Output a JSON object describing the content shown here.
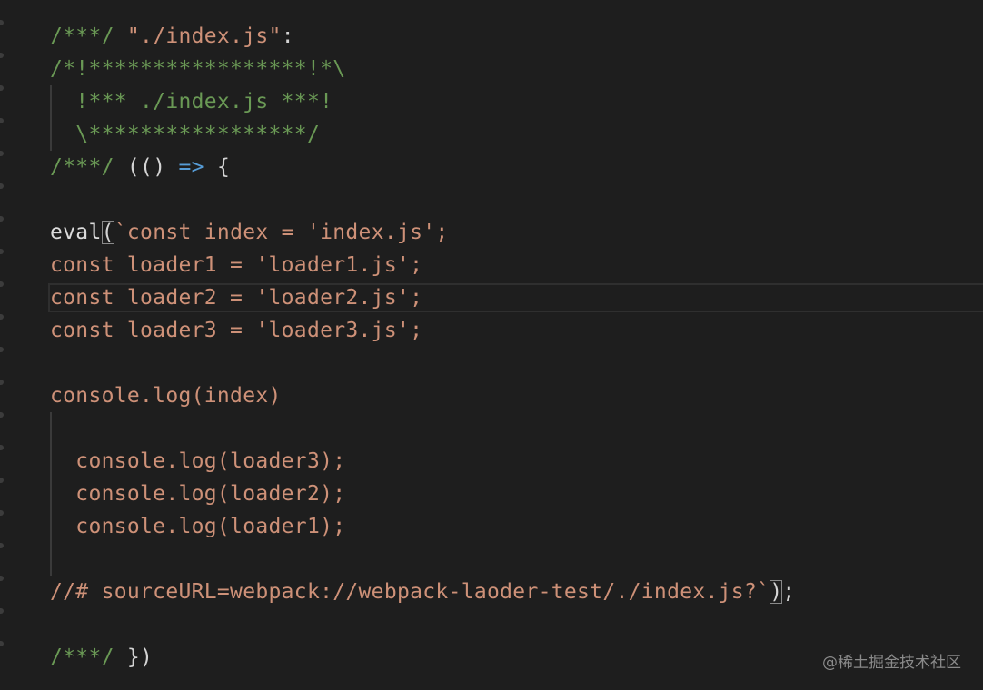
{
  "colors": {
    "background": "#1e1e1e",
    "comment": "#6a9955",
    "string": "#ce9178",
    "punctuation": "#d4d4d4",
    "arrow": "#569cd6"
  },
  "code": {
    "l1_comment": "/***/",
    "l1_string": "\"./index.js\"",
    "l1_colon": ":",
    "l2": "/*!*****************!*\\",
    "l3": "  !*** ./index.js ***!",
    "l4": "  \\*****************/",
    "l5_comment": "/***/",
    "l5_paren": " (()",
    "l5_arrow": " =>",
    "l5_brace": " {",
    "l7_eval": "eval",
    "l7_paren": "(",
    "l7_rest": "`const index = 'index.js';",
    "l8": "const loader1 = 'loader1.js';",
    "l9": "const loader2 = 'loader2.js';",
    "l10": "const loader3 = 'loader3.js';",
    "l12": "console.log(index)",
    "l14": "  console.log(loader3);",
    "l15": "  console.log(loader2);",
    "l16": "  console.log(loader1);",
    "l18_str": "//# sourceURL=webpack://webpack-laoder-test/./index.js?`",
    "l18_paren": ")",
    "l18_semi": ";",
    "l20_comment": "/***/",
    "l20_rest": " })"
  },
  "watermark": "@稀土掘金技术社区"
}
